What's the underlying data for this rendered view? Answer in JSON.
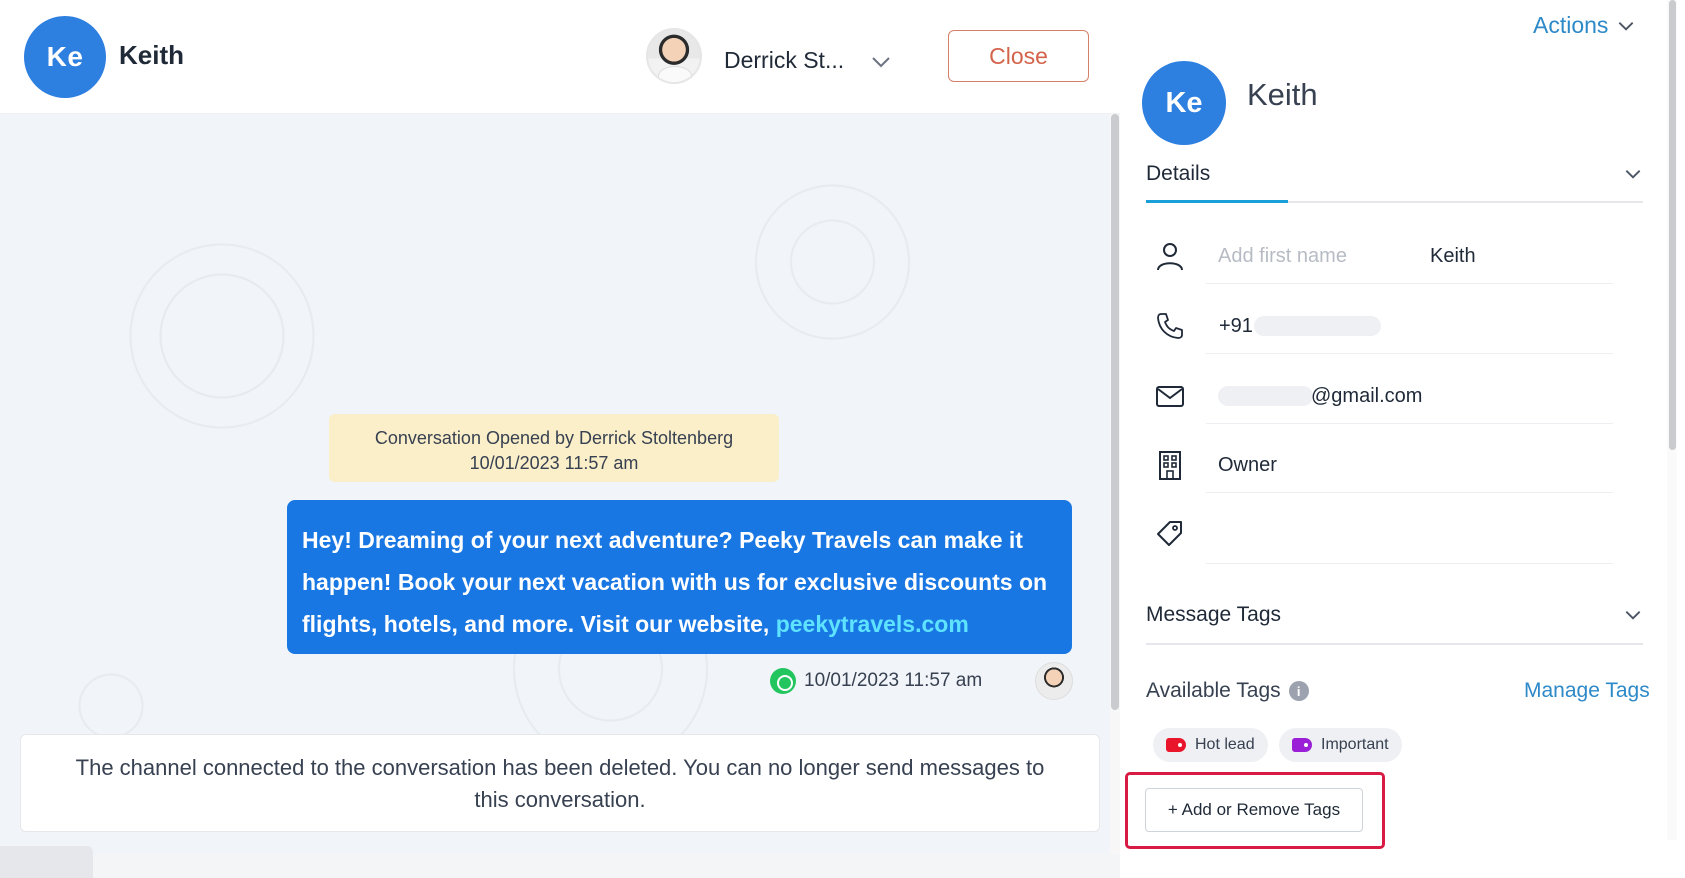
{
  "conversation": {
    "contact_initials": "Ke",
    "contact_name": "Keith",
    "agent_name": "Derrick St...",
    "close_label": "Close",
    "system_note_line1": "Conversation Opened by Derrick Stoltenberg",
    "system_note_line2": "10/01/2023 11:57 am",
    "message_text": "Hey! Dreaming of your next adventure? Peeky Travels can make it happen! Book your next vacation with us for exclusive discounts on flights, hotels, and more. Visit our website, ",
    "message_link": "peekytravels.com",
    "message_timestamp": "10/01/2023 11:57 am",
    "channel_deleted_notice": "The channel connected to the conversation has been deleted. You can no longer send messages to this conversation."
  },
  "details_panel": {
    "actions_label": "Actions",
    "contact_initials": "Ke",
    "contact_name": "Keith",
    "details_heading": "Details",
    "first_name_placeholder": "Add first name",
    "first_name_value": "Keith",
    "phone_prefix": "+91",
    "email_suffix": "@gmail.com",
    "company_value": "Owner",
    "message_tags_heading": "Message Tags",
    "available_tags_label": "Available Tags",
    "manage_tags_label": "Manage Tags",
    "tags": [
      {
        "label": "Hot lead",
        "color": "#e8152b"
      },
      {
        "label": "Important",
        "color": "#9b1fd6"
      }
    ],
    "add_remove_tags_label": "+ Add or Remove Tags"
  },
  "colors": {
    "accent_blue": "#1977e3",
    "avatar_blue": "#2d7fe0",
    "link_blue": "#2d89c8",
    "highlight_red": "#d81b43",
    "close_text": "#d4634b"
  }
}
